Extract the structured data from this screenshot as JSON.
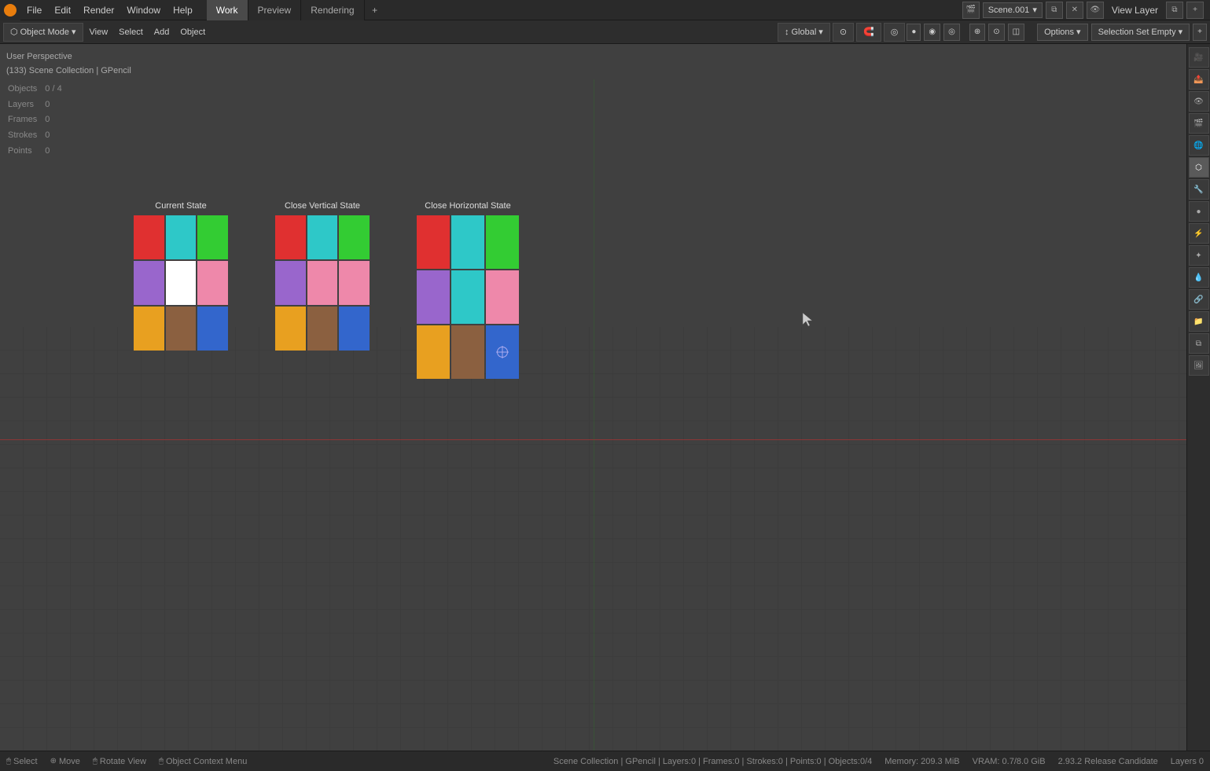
{
  "topMenu": {
    "items": [
      "File",
      "Edit",
      "Render",
      "Window",
      "Help"
    ],
    "activeWorkspace": "Work",
    "workspaces": [
      "Work",
      "Preview",
      "Rendering"
    ],
    "addTab": "+",
    "sceneName": "Scene.001",
    "viewLayerName": "View Layer"
  },
  "toolbar": {
    "objectMode": "Object Mode",
    "view": "View",
    "select": "Select",
    "add": "Add",
    "object": "Object",
    "global": "Global",
    "optionsLabel": "Options",
    "selectionSet": "Selection Set Empty"
  },
  "viewportInfo": {
    "perspective": "User Perspective",
    "collection": "(133) Scene Collection | GPencil",
    "stats": {
      "objects": {
        "label": "Objects",
        "value": "0 / 4"
      },
      "layers": {
        "label": "Layers",
        "value": "0"
      },
      "frames": {
        "label": "Frames",
        "value": "0"
      },
      "strokes": {
        "label": "Strokes",
        "value": "0"
      },
      "points": {
        "label": "Points",
        "value": "0"
      }
    }
  },
  "objects": [
    {
      "id": "current-state",
      "label": "Current State",
      "colors": [
        "#e03030",
        "#2ec8c8",
        "#33cc33",
        "#9966cc",
        "#ffffff",
        "#ee88aa",
        "#e8a020",
        "#8b6040",
        "#3366cc"
      ]
    },
    {
      "id": "close-vertical",
      "label": "Close Vertical State",
      "colors": [
        "#e03030",
        "#2ec8c8",
        "#33cc33",
        "#9966cc",
        "#ee88aa",
        "#ee88aa",
        "#e8a020",
        "#8b6040",
        "#3366cc"
      ]
    },
    {
      "id": "close-horizontal",
      "label": "Close Horizontal State",
      "colors": [
        "#e03030",
        "#2ec8c8",
        "#33cc33",
        "#9966cc",
        "#2ec8c8",
        "#ee88aa",
        "#e8a020",
        "#8b6040",
        "#3366cc"
      ]
    }
  ],
  "statusBar": {
    "select": "Select",
    "move": "Move",
    "rotateView": "Rotate View",
    "objectContextMenu": "Object Context Menu",
    "sceneInfo": "Scene Collection | GPencil | Layers:0 | Frames:0 | Strokes:0 | Points:0 | Objects:0/4",
    "memory": "Memory: 209.3 MiB",
    "vram": "VRAM: 0.7/8.0 GiB",
    "version": "2.93.2 Release Candidate",
    "layers": "Layers 0"
  },
  "icons": {
    "blender": "●",
    "chevron": "▾",
    "mesh": "▣",
    "curve": "⌒",
    "scene": "🎬",
    "render": "🎥",
    "output": "📤",
    "view": "👁",
    "object": "⬡",
    "modifier": "🔧",
    "material": "●",
    "data": "📊",
    "particles": "✦",
    "physics": "⚡",
    "constraints": "🔗",
    "collections": "📁",
    "close": "✕",
    "pin": "📌",
    "camera": "📷",
    "copy": "⧉",
    "settings": "⚙",
    "shading_solid": "●",
    "shading_material": "◉",
    "shading_render": "◎",
    "add": "+",
    "select_mode": "✦",
    "transform": "↕",
    "annotate": "✏",
    "measure": "📏",
    "relation": "🔗",
    "grease": "✍"
  }
}
